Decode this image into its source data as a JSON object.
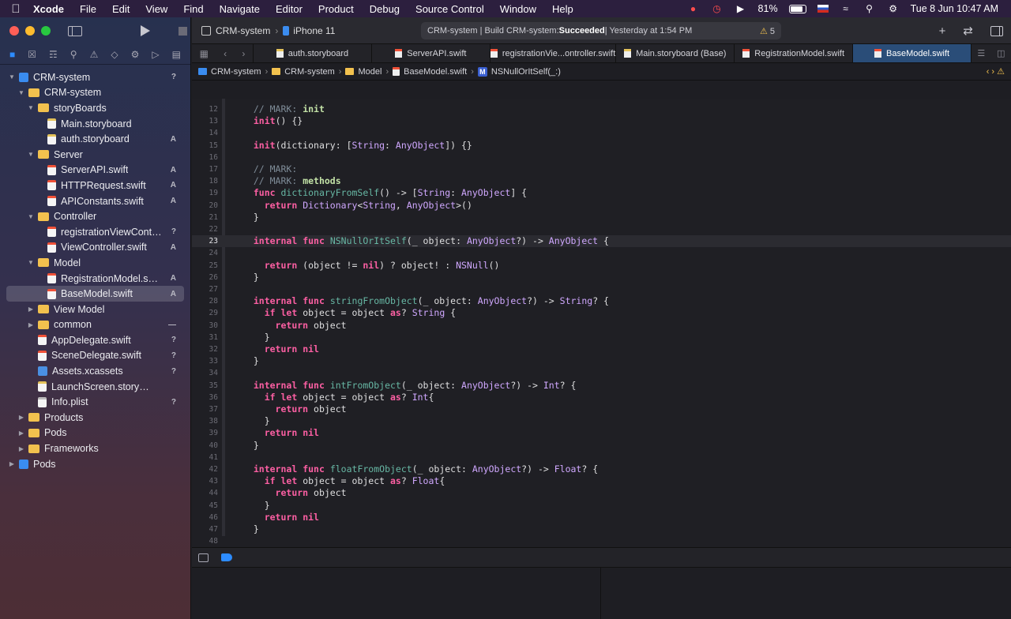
{
  "menubar": {
    "app": "Xcode",
    "items": [
      "File",
      "Edit",
      "View",
      "Find",
      "Navigate",
      "Editor",
      "Product",
      "Debug",
      "Source Control",
      "Window",
      "Help"
    ],
    "battery": "81%",
    "clock": "Tue 8 Jun  10:47 AM"
  },
  "navigator": {
    "tree": [
      {
        "label": "CRM-system",
        "indent": 0,
        "chev": "open",
        "icon": "proj",
        "badge": "?"
      },
      {
        "label": "CRM-system",
        "indent": 1,
        "chev": "open",
        "icon": "folder",
        "badge": ""
      },
      {
        "label": "storyBoards",
        "indent": 2,
        "chev": "open",
        "icon": "folder",
        "badge": ""
      },
      {
        "label": "Main.storyboard",
        "indent": 3,
        "chev": "",
        "icon": "story",
        "badge": ""
      },
      {
        "label": "auth.storyboard",
        "indent": 3,
        "chev": "",
        "icon": "story",
        "badge": "A"
      },
      {
        "label": "Server",
        "indent": 2,
        "chev": "open",
        "icon": "folder",
        "badge": ""
      },
      {
        "label": "ServerAPI.swift",
        "indent": 3,
        "chev": "",
        "icon": "swift",
        "badge": "A"
      },
      {
        "label": "HTTPRequest.swift",
        "indent": 3,
        "chev": "",
        "icon": "swift",
        "badge": "A"
      },
      {
        "label": "APIConstants.swift",
        "indent": 3,
        "chev": "",
        "icon": "swift",
        "badge": "A"
      },
      {
        "label": "Controller",
        "indent": 2,
        "chev": "open",
        "icon": "folder",
        "badge": ""
      },
      {
        "label": "registrationViewContr...",
        "indent": 3,
        "chev": "",
        "icon": "swift",
        "badge": "?"
      },
      {
        "label": "ViewController.swift",
        "indent": 3,
        "chev": "",
        "icon": "swift",
        "badge": "A"
      },
      {
        "label": "Model",
        "indent": 2,
        "chev": "open",
        "icon": "folder",
        "badge": ""
      },
      {
        "label": "RegistrationModel.swift",
        "indent": 3,
        "chev": "",
        "icon": "swift",
        "badge": "A"
      },
      {
        "label": "BaseModel.swift",
        "indent": 3,
        "chev": "",
        "icon": "swift",
        "badge": "A",
        "selected": true
      },
      {
        "label": "View Model",
        "indent": 2,
        "chev": "closed",
        "icon": "folder",
        "badge": ""
      },
      {
        "label": "common",
        "indent": 2,
        "chev": "closed",
        "icon": "folder",
        "badge": "—"
      },
      {
        "label": "AppDelegate.swift",
        "indent": 2,
        "chev": "",
        "icon": "swift",
        "badge": "?"
      },
      {
        "label": "SceneDelegate.swift",
        "indent": 2,
        "chev": "",
        "icon": "swift",
        "badge": "?"
      },
      {
        "label": "Assets.xcassets",
        "indent": 2,
        "chev": "",
        "icon": "assets",
        "badge": "?"
      },
      {
        "label": "LaunchScreen.storyboard",
        "indent": 2,
        "chev": "",
        "icon": "story",
        "badge": ""
      },
      {
        "label": "Info.plist",
        "indent": 2,
        "chev": "",
        "icon": "plist",
        "badge": "?"
      },
      {
        "label": "Products",
        "indent": 1,
        "chev": "closed",
        "icon": "folder",
        "badge": ""
      },
      {
        "label": "Pods",
        "indent": 1,
        "chev": "closed",
        "icon": "folder",
        "badge": ""
      },
      {
        "label": "Frameworks",
        "indent": 1,
        "chev": "closed",
        "icon": "folder",
        "badge": ""
      },
      {
        "label": "Pods",
        "indent": 0,
        "chev": "closed",
        "icon": "proj",
        "badge": ""
      }
    ]
  },
  "toolbar": {
    "scheme": "CRM-system",
    "device": "iPhone 11",
    "status_prefix": "CRM-system | Build CRM-system: ",
    "status_bold": "Succeeded",
    "status_suffix": " | Yesterday at 1:54 PM",
    "warning_count": "5"
  },
  "tabs": [
    {
      "label": "auth.storyboard",
      "kind": "sb"
    },
    {
      "label": "ServerAPI.swift",
      "kind": "swift"
    },
    {
      "label": "registrationVie...ontroller.swift",
      "kind": "swift"
    },
    {
      "label": "Main.storyboard (Base)",
      "kind": "sb"
    },
    {
      "label": "RegistrationModel.swift",
      "kind": "swift"
    },
    {
      "label": "BaseModel.swift",
      "kind": "swift",
      "active": true
    }
  ],
  "jumpbar": [
    {
      "label": "CRM-system",
      "icon": "proj"
    },
    {
      "label": "CRM-system",
      "icon": "folder"
    },
    {
      "label": "Model",
      "icon": "folder"
    },
    {
      "label": "BaseModel.swift",
      "icon": "swift"
    },
    {
      "label": "NSNullOrItSelf(_:)",
      "icon": "method"
    }
  ],
  "code": {
    "current_line": 23,
    "lines": [
      {
        "n": "12",
        "t": "  // MARK: init"
      },
      {
        "n": "13",
        "t": "  init() {}"
      },
      {
        "n": "14",
        "t": ""
      },
      {
        "n": "15",
        "t": "  init(dictionary: [String: AnyObject]) {}"
      },
      {
        "n": "16",
        "t": ""
      },
      {
        "n": "17",
        "t": "  // MARK:"
      },
      {
        "n": "18",
        "t": "  // MARK: methods"
      },
      {
        "n": "19",
        "t": "  func dictionaryFromSelf() -> [String: AnyObject] {"
      },
      {
        "n": "20",
        "t": "    return Dictionary<String, AnyObject>()"
      },
      {
        "n": "21",
        "t": "  }"
      },
      {
        "n": "22",
        "t": ""
      },
      {
        "n": "23",
        "t": "  internal func NSNullOrItSelf(_ object: AnyObject?) -> AnyObject {"
      },
      {
        "n": "24",
        "t": ""
      },
      {
        "n": "25",
        "t": "    return (object != nil) ? object! : NSNull()"
      },
      {
        "n": "26",
        "t": "  }"
      },
      {
        "n": "27",
        "t": ""
      },
      {
        "n": "28",
        "t": "  internal func stringFromObject(_ object: AnyObject?) -> String? {"
      },
      {
        "n": "29",
        "t": "    if let object = object as? String {"
      },
      {
        "n": "30",
        "t": "      return object"
      },
      {
        "n": "31",
        "t": "    }"
      },
      {
        "n": "32",
        "t": "    return nil"
      },
      {
        "n": "33",
        "t": "  }"
      },
      {
        "n": "34",
        "t": ""
      },
      {
        "n": "35",
        "t": "  internal func intFromObject(_ object: AnyObject?) -> Int? {"
      },
      {
        "n": "36",
        "t": "    if let object = object as? Int{"
      },
      {
        "n": "37",
        "t": "      return object"
      },
      {
        "n": "38",
        "t": "    }"
      },
      {
        "n": "39",
        "t": "    return nil"
      },
      {
        "n": "40",
        "t": "  }"
      },
      {
        "n": "41",
        "t": ""
      },
      {
        "n": "42",
        "t": "  internal func floatFromObject(_ object: AnyObject?) -> Float? {"
      },
      {
        "n": "43",
        "t": "    if let object = object as? Float{"
      },
      {
        "n": "44",
        "t": "      return object"
      },
      {
        "n": "45",
        "t": "    }"
      },
      {
        "n": "46",
        "t": "    return nil"
      },
      {
        "n": "47",
        "t": "  }"
      },
      {
        "n": "48",
        "t": ""
      }
    ]
  }
}
